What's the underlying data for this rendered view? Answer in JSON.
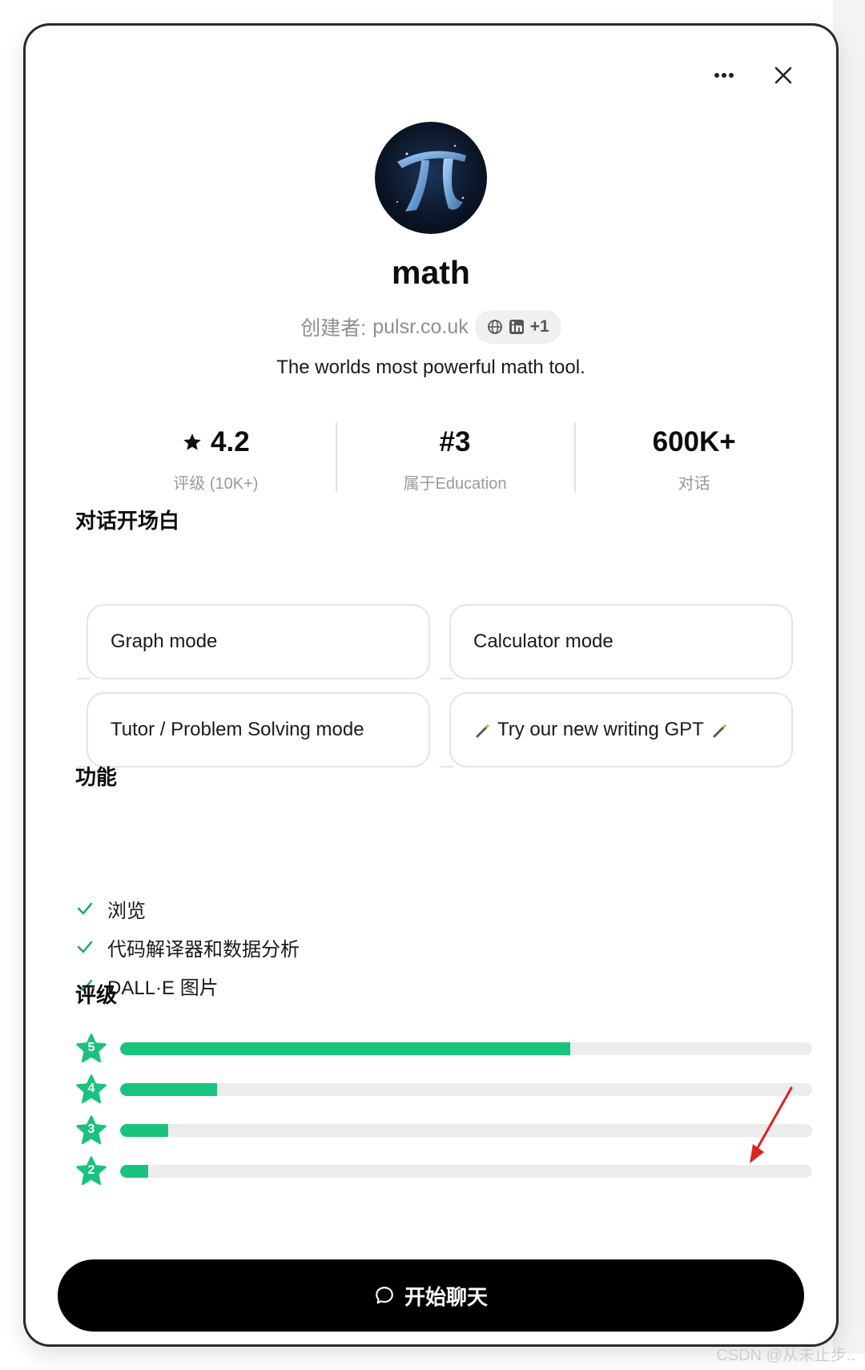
{
  "header": {
    "more_icon": "more-horizontal-icon",
    "close_icon": "close-icon"
  },
  "profile": {
    "title": "math",
    "creator_label": "创建者:",
    "creator_name": "pulsr.co.uk",
    "links_extra": "+1",
    "description": "The worlds most powerful math tool."
  },
  "stats": [
    {
      "value": "4.2",
      "label": "评级 (10K+)"
    },
    {
      "value": "#3",
      "label": "属于Education"
    },
    {
      "value": "600K+",
      "label": "对话"
    }
  ],
  "starters": {
    "title": "对话开场白",
    "items": [
      "Graph mode",
      "Calculator mode",
      "Tutor / Problem Solving mode",
      "Try our new writing GPT"
    ]
  },
  "features": {
    "title": "功能",
    "items": [
      "浏览",
      "代码解译器和数据分析",
      "DALL·E 图片"
    ]
  },
  "ratings": {
    "title": "评级",
    "rows": [
      {
        "stars": "5",
        "share": 0.65
      },
      {
        "stars": "4",
        "share": 0.14
      },
      {
        "stars": "3",
        "share": 0.07
      },
      {
        "stars": "2",
        "share": 0.04
      }
    ]
  },
  "footer": {
    "start_label": "开始聊天"
  },
  "watermark": "CSDN @从未止步..",
  "colors": {
    "accent": "#19c37d",
    "button": "#000000"
  }
}
